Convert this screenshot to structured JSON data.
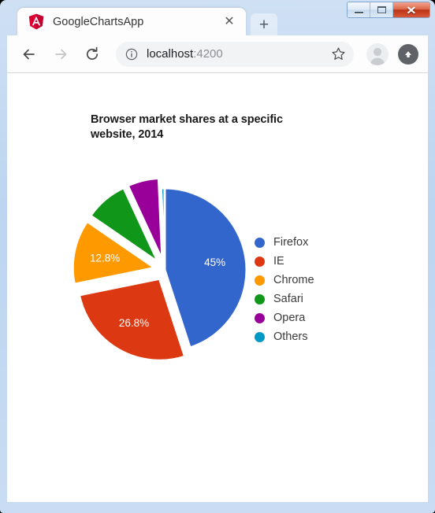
{
  "window": {
    "controls": {
      "minimize_label": "–",
      "maximize_label": "",
      "close_label": "✕"
    }
  },
  "tab": {
    "title": "GoogleChartsApp",
    "favicon": "angular-logo-icon",
    "close_label": "✕",
    "new_tab_label": "+"
  },
  "toolbar": {
    "back_label": "←",
    "forward_label": "→",
    "reload_label": "⟳",
    "site_info_icon": "info-circle-icon",
    "url_host": "localhost",
    "url_port": ":4200",
    "url_full": "localhost:4200",
    "bookmark_icon": "star-outline-icon",
    "profile_icon": "avatar-icon",
    "menu_icon": "update-arrow-icon"
  },
  "chart_data": {
    "type": "pie",
    "title": "Browser market shares at a specific website, 2014",
    "xlabel": "",
    "ylabel": "",
    "legend_position": "right",
    "grid": false,
    "categories": [
      "Firefox",
      "IE",
      "Chrome",
      "Safari",
      "Opera",
      "Others"
    ],
    "values": [
      45.0,
      26.8,
      12.8,
      8.5,
      6.2,
      0.7
    ],
    "labels": [
      "45%",
      "26.8%",
      "12.8%",
      "",
      "",
      ""
    ],
    "colors": [
      "#3366cc",
      "#dc3912",
      "#ff9900",
      "#109618",
      "#990099",
      "#0099c6"
    ],
    "exploded": [
      false,
      true,
      true,
      true,
      true,
      false
    ],
    "start_angle": 0,
    "units": "percent"
  },
  "legend": {
    "items": [
      {
        "label": "Firefox",
        "color": "#3366cc"
      },
      {
        "label": "IE",
        "color": "#dc3912"
      },
      {
        "label": "Chrome",
        "color": "#ff9900"
      },
      {
        "label": "Safari",
        "color": "#109618"
      },
      {
        "label": "Opera",
        "color": "#990099"
      },
      {
        "label": "Others",
        "color": "#0099c6"
      }
    ]
  }
}
